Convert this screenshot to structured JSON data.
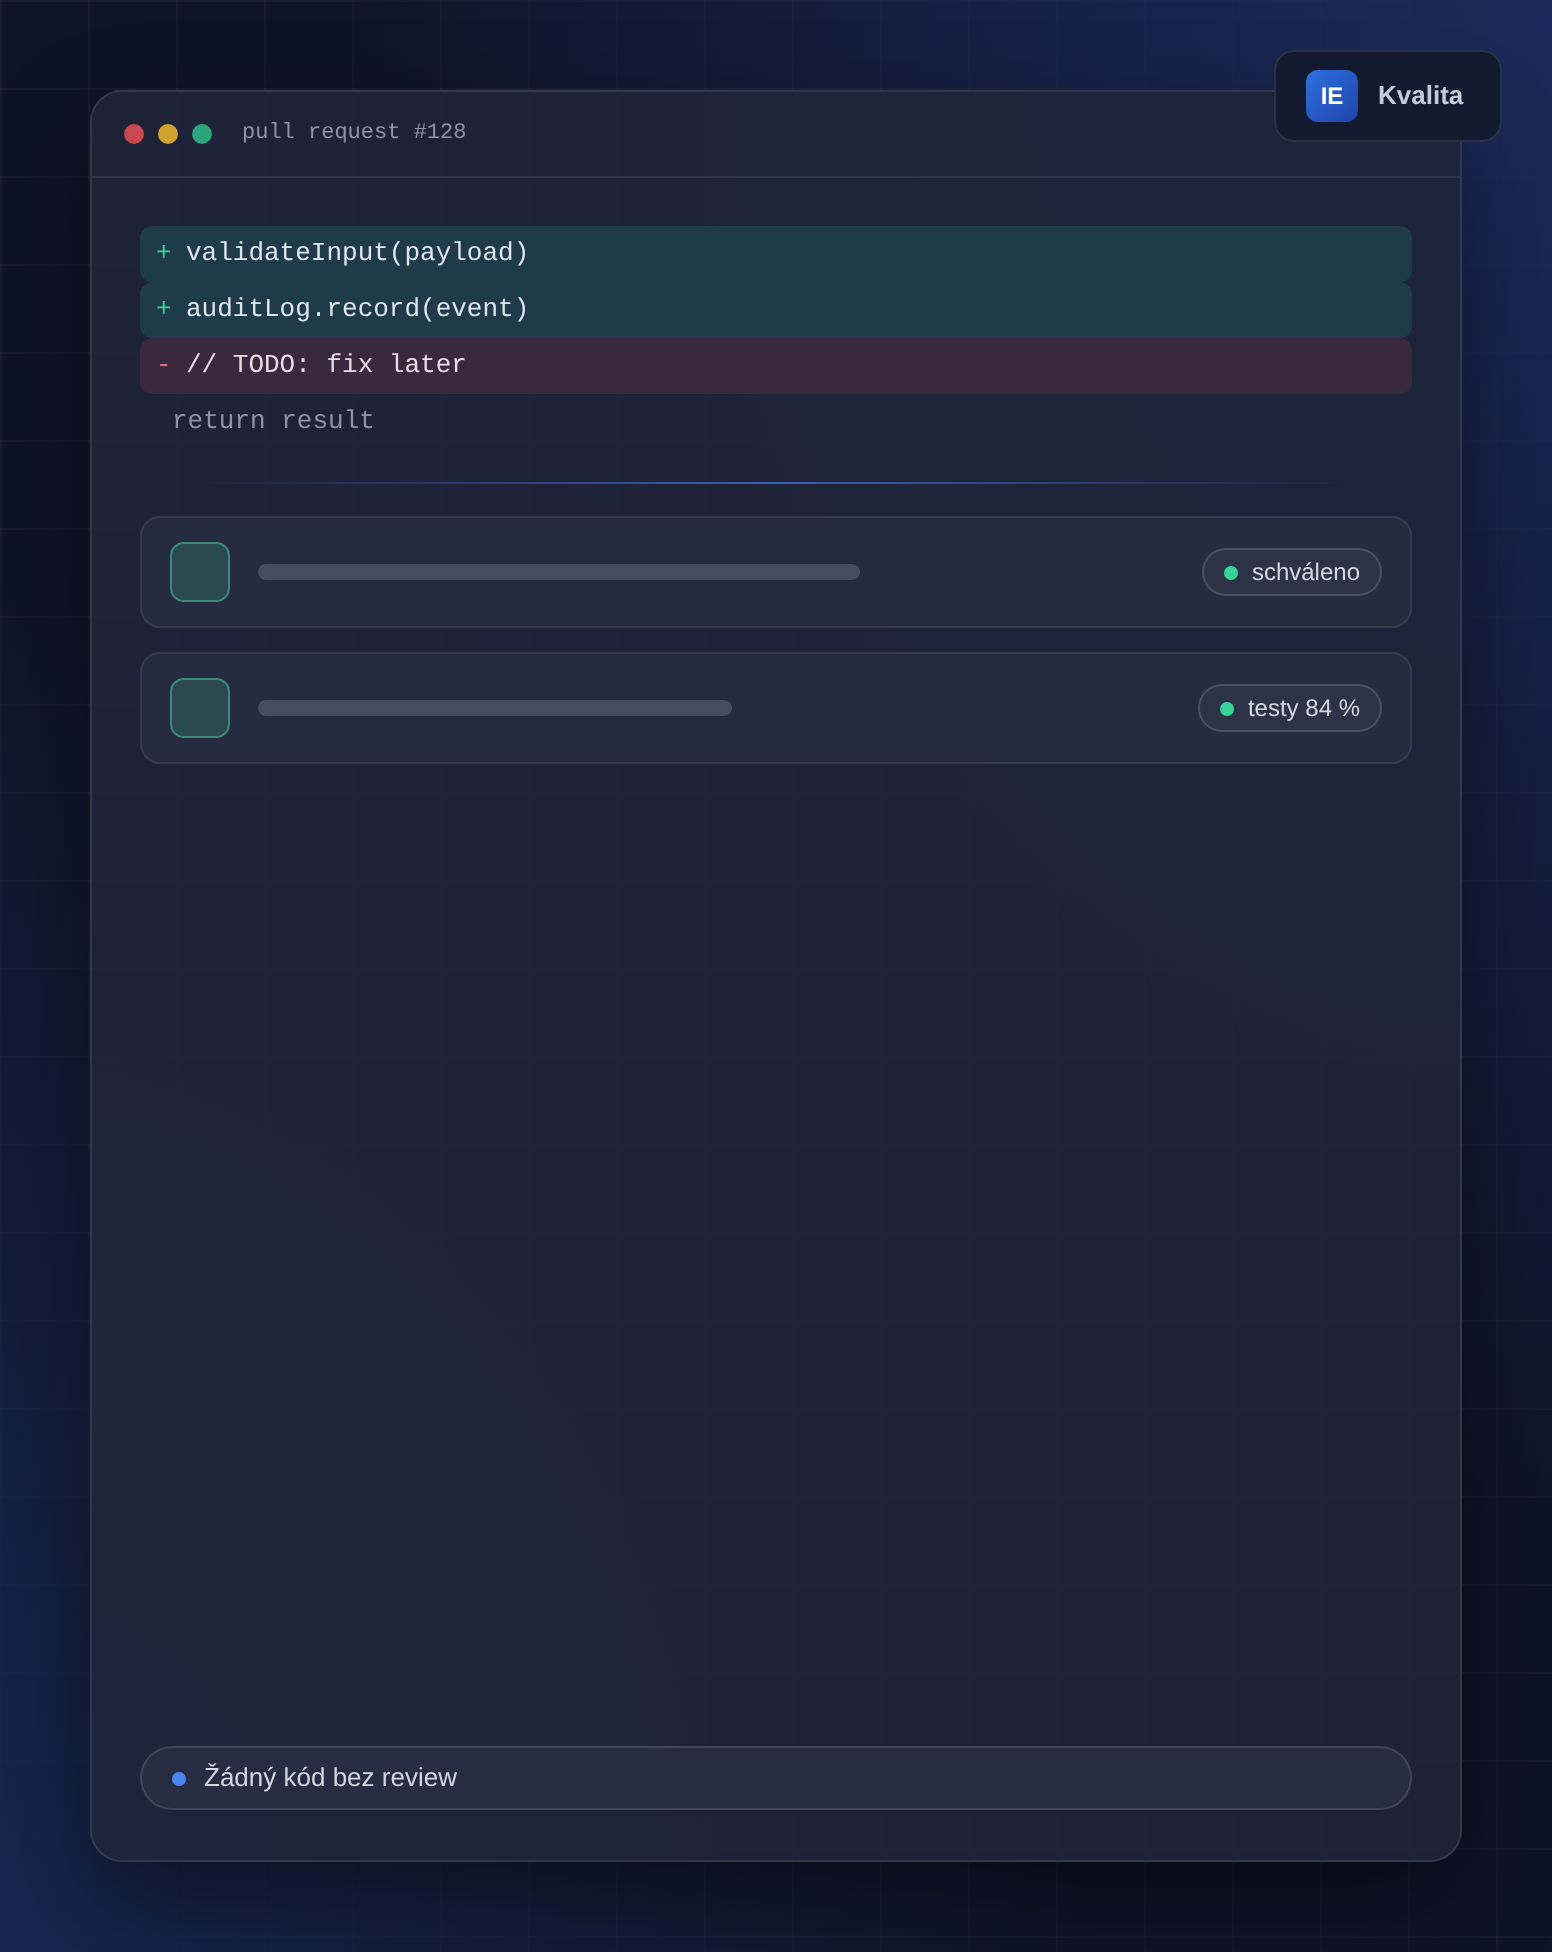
{
  "window": {
    "title": "pull request #128"
  },
  "badge": {
    "logo": "IE",
    "label": "Kvalita"
  },
  "diff": [
    {
      "kind": "added",
      "sign": "+",
      "code": "validateInput(payload)"
    },
    {
      "kind": "added",
      "sign": "+",
      "code": "auditLog.record(event)"
    },
    {
      "kind": "removed",
      "sign": "-",
      "code": "// TODO: fix later"
    },
    {
      "kind": "context",
      "code": "return result"
    }
  ],
  "checks": [
    {
      "label": "schváleno"
    },
    {
      "label": "testy 84 %"
    }
  ],
  "footer": {
    "text": "Žádný kód bez review"
  }
}
